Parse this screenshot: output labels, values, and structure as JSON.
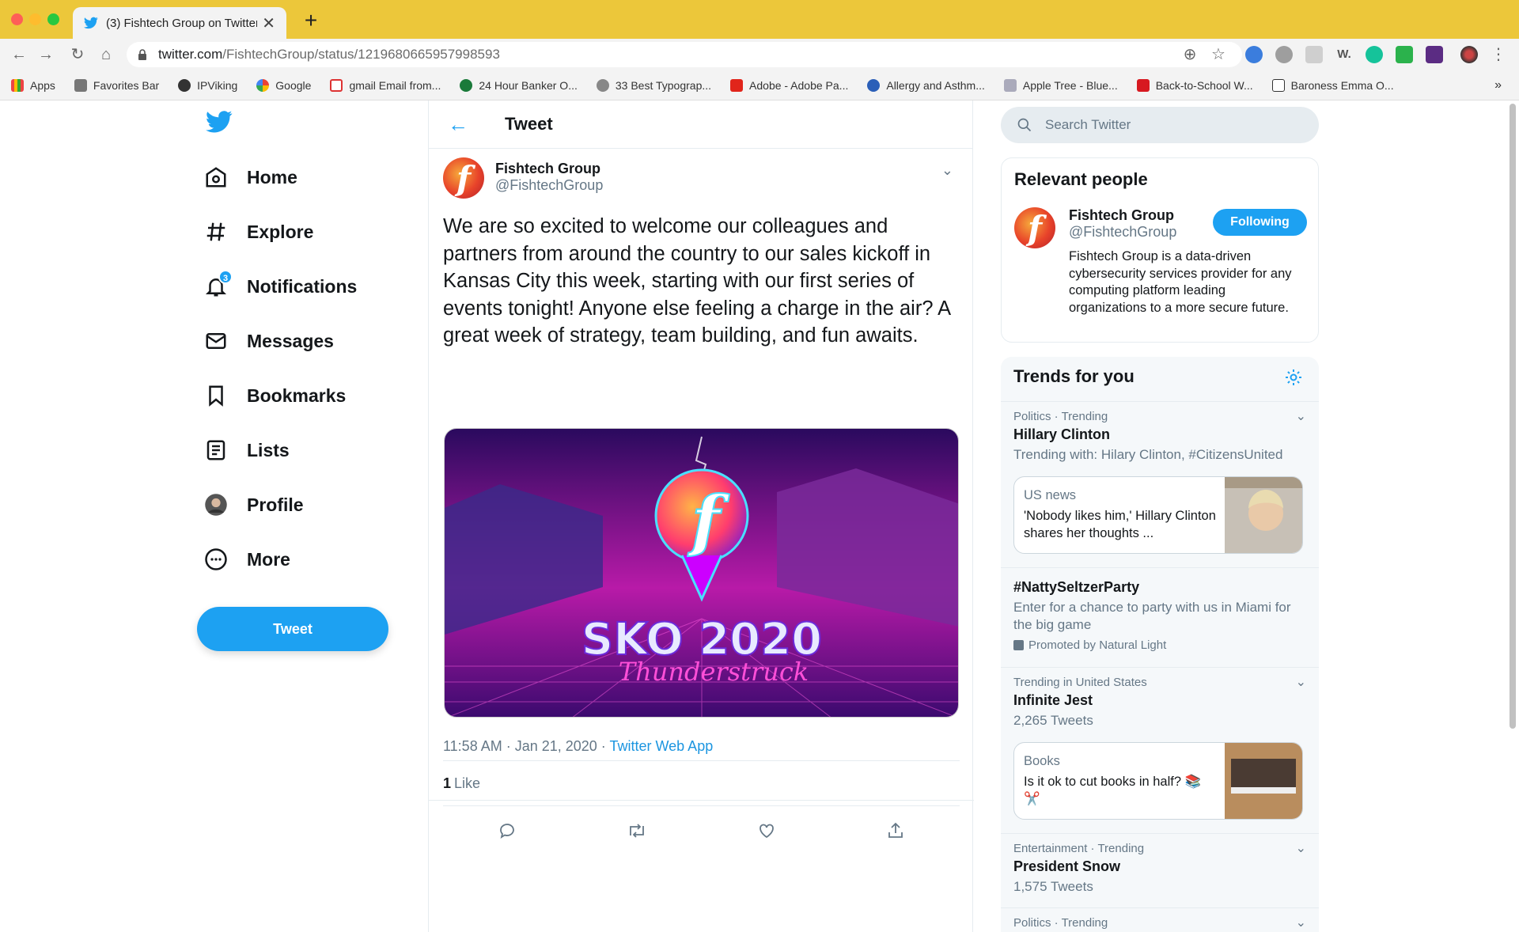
{
  "browser": {
    "tab_title": "(3) Fishtech Group on Twitter:",
    "url_host": "twitter.com",
    "url_path": "/FishtechGroup/status/1219680665957998593",
    "bookmarks": [
      {
        "label": "Apps"
      },
      {
        "label": "Favorites Bar"
      },
      {
        "label": "IPViking"
      },
      {
        "label": "Google"
      },
      {
        "label": "gmail Email from..."
      },
      {
        "label": "24 Hour Banker O..."
      },
      {
        "label": "33 Best Typograp..."
      },
      {
        "label": "Adobe - Adobe Pa..."
      },
      {
        "label": "Allergy and Asthm..."
      },
      {
        "label": "Apple Tree - Blue..."
      },
      {
        "label": "Back-to-School W..."
      },
      {
        "label": "Baroness Emma O..."
      }
    ],
    "more": "»"
  },
  "nav": {
    "items": [
      {
        "label": "Home",
        "icon": "home-icon"
      },
      {
        "label": "Explore",
        "icon": "hashtag-icon"
      },
      {
        "label": "Notifications",
        "icon": "bell-icon"
      },
      {
        "label": "Messages",
        "icon": "envelope-icon"
      },
      {
        "label": "Bookmarks",
        "icon": "bookmark-icon"
      },
      {
        "label": "Lists",
        "icon": "list-icon"
      },
      {
        "label": "Profile",
        "icon": "avatar-icon"
      },
      {
        "label": "More",
        "icon": "more-icon"
      }
    ],
    "notification_count": "3",
    "tweet_button": "Tweet"
  },
  "center": {
    "header_title": "Tweet",
    "tweet": {
      "author_name": "Fishtech Group",
      "author_handle": "@FishtechGroup",
      "text": "We are so excited to welcome our colleagues and partners from around the country to our sales kickoff in Kansas City this week, starting with our first series of events tonight! Anyone else feeling a charge in the air? A great week of strategy, team building, and fun awaits.",
      "media_title": "SKO 2020",
      "media_subtitle": "Thunderstruck",
      "timestamp": "11:58 AM · Jan 21, 2020 · ",
      "source": "Twitter Web App",
      "like_count": "1",
      "like_label": "Like"
    }
  },
  "right": {
    "search_placeholder": "Search Twitter",
    "relevant": {
      "title": "Relevant people",
      "name": "Fishtech Group",
      "handle": "@FishtechGroup",
      "follow_label": "Following",
      "bio": "Fishtech Group is a data-driven cybersecurity services provider for any computing platform leading organizations to a more secure future."
    },
    "trends": {
      "title": "Trends for you",
      "items": [
        {
          "context": "Politics · Trending",
          "name": "Hillary Clinton",
          "sub": "Trending with: Hilary Clinton, #CitizensUnited",
          "card": {
            "category": "US news",
            "text": "'Nobody likes him,' Hillary Clinton shares her thoughts ..."
          }
        },
        {
          "context": "",
          "name": "#NattySeltzerParty",
          "sub": "Enter for a chance to party with us in Miami for the big game",
          "promoted": "Promoted by Natural Light"
        },
        {
          "context": "Trending in United States",
          "name": "Infinite Jest",
          "sub": "2,265 Tweets",
          "card": {
            "category": "Books",
            "text": "Is it ok to cut books in half? 📚 ✂️"
          }
        },
        {
          "context": "Entertainment · Trending",
          "name": "President Snow",
          "sub": "1,575 Tweets"
        },
        {
          "context": "Politics · Trending",
          "name": "",
          "sub": ""
        }
      ]
    }
  },
  "colors": {
    "accent": "#1da1f2",
    "chrome": "#ecc73a",
    "text": "#14171a",
    "muted": "#657786"
  }
}
